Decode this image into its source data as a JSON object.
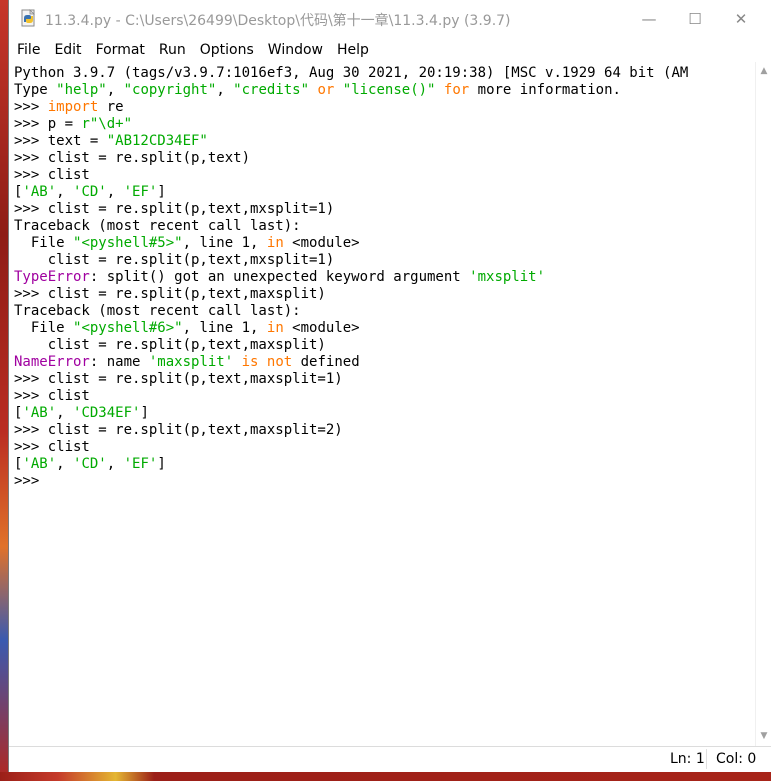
{
  "window": {
    "title": "11.3.4.py - C:\\Users\\26499\\Desktop\\代码\\第十一章\\11.3.4.py (3.9.7)",
    "app_icon": "python-idle-icon",
    "controls": {
      "minimize": "—",
      "maximize": "☐",
      "close": "✕"
    }
  },
  "menu": [
    "File",
    "Edit",
    "Format",
    "Run",
    "Options",
    "Window",
    "Help"
  ],
  "shell": {
    "lines": [
      [
        {
          "t": "Python 3.9.7 (tags/v3.9.7:1016ef3, Aug 30 2021, 20:19:38) [MSC v.1929 64 bit (AM"
        }
      ],
      [
        {
          "t": "Type "
        },
        {
          "t": "\"help\"",
          "c": "str"
        },
        {
          "t": ", "
        },
        {
          "t": "\"copyright\"",
          "c": "str"
        },
        {
          "t": ", "
        },
        {
          "t": "\"credits\"",
          "c": "str"
        },
        {
          "t": " "
        },
        {
          "t": "or",
          "c": "kw"
        },
        {
          "t": " "
        },
        {
          "t": "\"license()\"",
          "c": "str"
        },
        {
          "t": " "
        },
        {
          "t": "for",
          "c": "kw"
        },
        {
          "t": " more information."
        }
      ],
      [
        {
          "t": ">>> "
        },
        {
          "t": "import",
          "c": "kw"
        },
        {
          "t": " re"
        }
      ],
      [
        {
          "t": ">>> p = "
        },
        {
          "t": "r\"\\d+\"",
          "c": "str"
        }
      ],
      [
        {
          "t": ">>> text = "
        },
        {
          "t": "\"AB12CD34EF\"",
          "c": "str"
        }
      ],
      [
        {
          "t": ">>> clist = re.split(p,text)"
        }
      ],
      [
        {
          "t": ">>> clist"
        }
      ],
      [
        {
          "t": "["
        },
        {
          "t": "'AB'",
          "c": "str"
        },
        {
          "t": ", "
        },
        {
          "t": "'CD'",
          "c": "str"
        },
        {
          "t": ", "
        },
        {
          "t": "'EF'",
          "c": "str"
        },
        {
          "t": "]"
        }
      ],
      [
        {
          "t": ">>> clist = re.split(p,text,mxsplit=1)"
        }
      ],
      [
        {
          "t": "Traceback (most recent call last):"
        }
      ],
      [
        {
          "t": "  File "
        },
        {
          "t": "\"<pyshell#5>\"",
          "c": "str"
        },
        {
          "t": ", line 1, "
        },
        {
          "t": "in",
          "c": "kw"
        },
        {
          "t": " <module>"
        }
      ],
      [
        {
          "t": "    clist = re.split(p,text,mxsplit=1)"
        }
      ],
      [
        {
          "t": "TypeError",
          "c": "err"
        },
        {
          "t": ": split() got an unexpected keyword argument "
        },
        {
          "t": "'mxsplit'",
          "c": "str"
        }
      ],
      [
        {
          "t": ">>> clist = re.split(p,text,maxsplit)"
        }
      ],
      [
        {
          "t": "Traceback (most recent call last):"
        }
      ],
      [
        {
          "t": "  File "
        },
        {
          "t": "\"<pyshell#6>\"",
          "c": "str"
        },
        {
          "t": ", line 1, "
        },
        {
          "t": "in",
          "c": "kw"
        },
        {
          "t": " <module>"
        }
      ],
      [
        {
          "t": "    clist = re.split(p,text,maxsplit)"
        }
      ],
      [
        {
          "t": "NameError",
          "c": "err"
        },
        {
          "t": ": name "
        },
        {
          "t": "'maxsplit'",
          "c": "str"
        },
        {
          "t": " "
        },
        {
          "t": "is not",
          "c": "kw"
        },
        {
          "t": " defined"
        }
      ],
      [
        {
          "t": ">>> clist = re.split(p,text,maxsplit=1)"
        }
      ],
      [
        {
          "t": ">>> clist"
        }
      ],
      [
        {
          "t": "["
        },
        {
          "t": "'AB'",
          "c": "str"
        },
        {
          "t": ", "
        },
        {
          "t": "'CD34EF'",
          "c": "str"
        },
        {
          "t": "]"
        }
      ],
      [
        {
          "t": ">>> clist = re.split(p,text,maxsplit=2)"
        }
      ],
      [
        {
          "t": ">>> clist"
        }
      ],
      [
        {
          "t": "["
        },
        {
          "t": "'AB'",
          "c": "str"
        },
        {
          "t": ", "
        },
        {
          "t": "'CD'",
          "c": "str"
        },
        {
          "t": ", "
        },
        {
          "t": "'EF'",
          "c": "str"
        },
        {
          "t": "]"
        }
      ],
      [
        {
          "t": ">>> "
        }
      ]
    ]
  },
  "scrollbar": {
    "up": "▲",
    "down": "▼"
  },
  "status": {
    "ln": "Ln: 1",
    "col": "Col: 0"
  },
  "colors": {
    "keyword": "#ff7700",
    "string": "#00aa00",
    "error": "#a000a0",
    "title_text": "#999999"
  }
}
